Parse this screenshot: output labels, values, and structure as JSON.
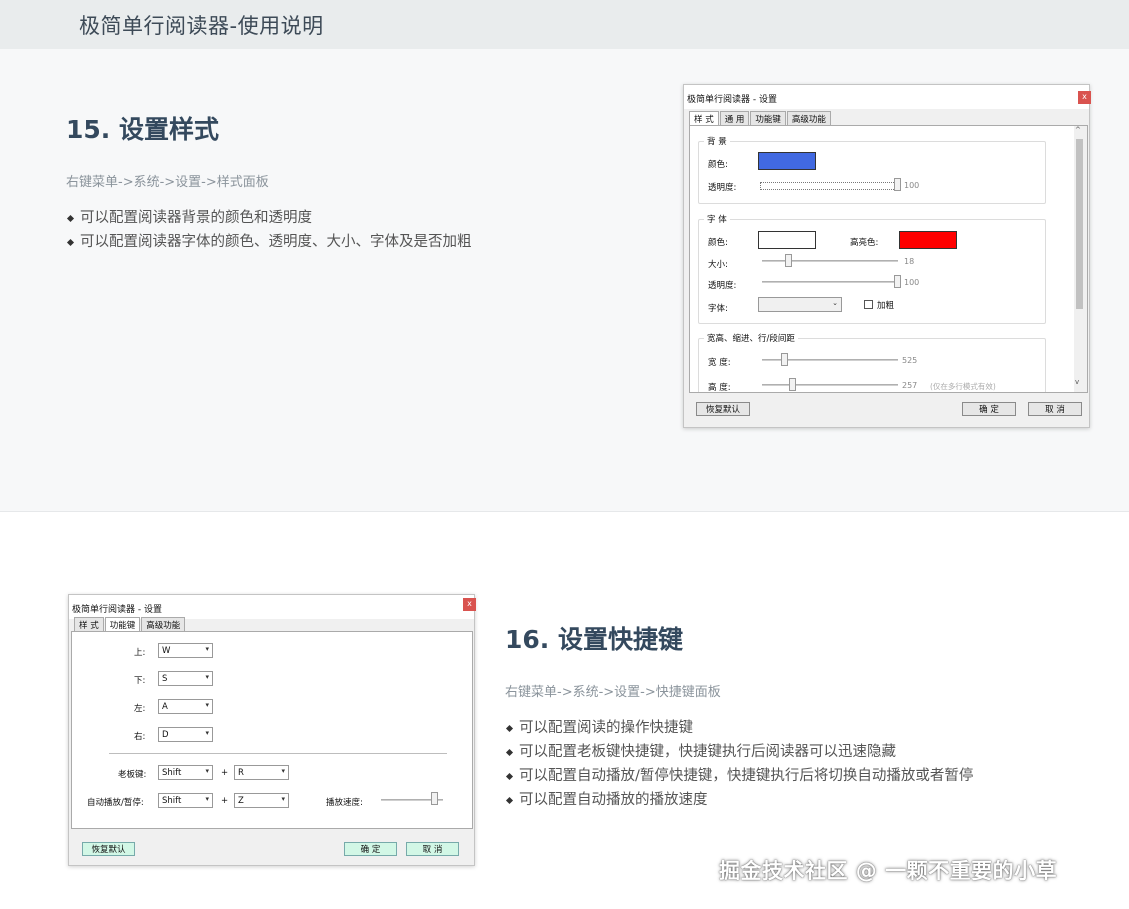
{
  "header": {
    "title": "极简单行阅读器-使用说明"
  },
  "section15": {
    "heading": "15. 设置样式",
    "path": "右键菜单->系统->设置->样式面板",
    "bullets": [
      "可以配置阅读器背景的颜色和透明度",
      "可以配置阅读器字体的颜色、透明度、大小、字体及是否加粗"
    ],
    "dialog": {
      "title": "极简单行阅读器 - 设置",
      "close": "x",
      "tabs": [
        "样 式",
        "通 用",
        "功能键",
        "高级功能"
      ],
      "background_group": {
        "label": "背 景",
        "color_label": "颜色:",
        "color": "#4169e1",
        "opacity_label": "透明度:",
        "opacity_value": "100"
      },
      "font_group": {
        "label": "字 体",
        "color_label": "颜色:",
        "color": "#ffffff",
        "highlight_label": "高亮色:",
        "highlight_color": "#ff0000",
        "size_label": "大小:",
        "size_value": "18",
        "opacity_label": "透明度:",
        "opacity_value": "100",
        "font_label": "字体:",
        "font_value": "",
        "bold_label": "加粗"
      },
      "layout_group": {
        "label": "宽高、缩进、行/段间距",
        "width_label": "宽 度:",
        "width_value": "525",
        "height_label": "高 度:",
        "height_value": "257",
        "height_note": "(仅在多行模式有效)"
      },
      "restore_button": "恢复默认",
      "ok_button": "确 定",
      "cancel_button": "取 消"
    }
  },
  "section16": {
    "heading": "16. 设置快捷键",
    "path": "右键菜单->系统->设置->快捷键面板",
    "bullets": [
      "可以配置阅读的操作快捷键",
      "可以配置老板键快捷键，快捷键执行后阅读器可以迅速隐藏",
      "可以配置自动播放/暂停快捷键，快捷键执行后将切换自动播放或者暂停",
      "可以配置自动播放的播放速度"
    ],
    "dialog": {
      "title": "极简单行阅读器 - 设置",
      "close": "x",
      "tabs": [
        "样 式",
        "功能键",
        "高级功能"
      ],
      "up_label": "上:",
      "up_value": "W",
      "down_label": "下:",
      "down_value": "S",
      "left_label": "左:",
      "left_value": "A",
      "right_label": "右:",
      "right_value": "D",
      "boss_label": "老板键:",
      "boss_mod": "Shift",
      "boss_key": "R",
      "auto_label": "自动播放/暂停:",
      "auto_mod": "Shift",
      "auto_key": "Z",
      "plus": "+",
      "speed_label": "播放速度:",
      "restore_button": "恢复默认",
      "ok_button": "确 定",
      "cancel_button": "取 消"
    }
  },
  "watermark": "掘金技术社区 @ 一颗不重要的小草"
}
